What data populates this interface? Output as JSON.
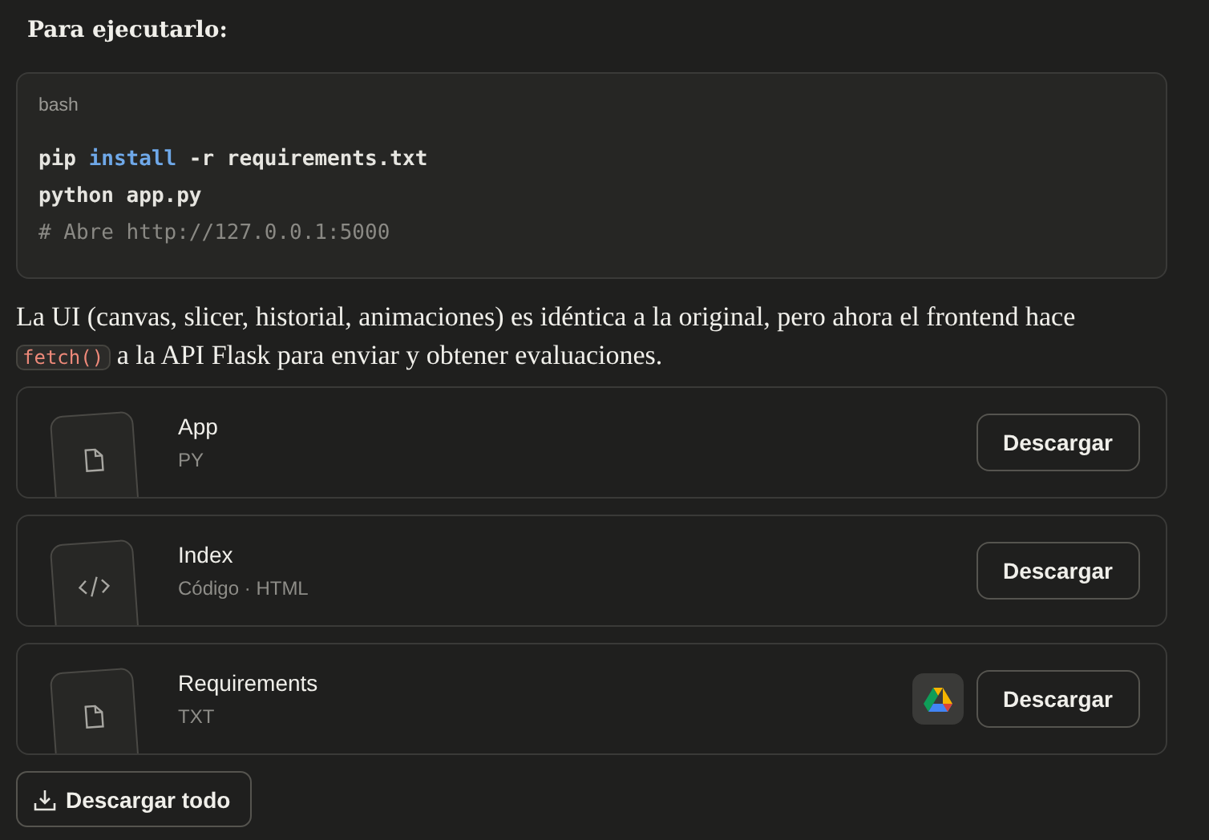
{
  "heading": "Para ejecutarlo:",
  "code_block": {
    "language": "bash",
    "lines": [
      [
        {
          "kind": "plain",
          "text": "pip "
        },
        {
          "kind": "keyword",
          "text": "install"
        },
        {
          "kind": "plain",
          "text": " -r requirements.txt"
        }
      ],
      [
        {
          "kind": "plain",
          "text": "python app.py"
        }
      ],
      [
        {
          "kind": "comment",
          "text": "# Abre http://127.0.0.1:5000"
        }
      ]
    ]
  },
  "paragraph": [
    {
      "kind": "text",
      "text": "La UI (canvas, slicer, historial, animaciones) es idéntica a la original, pero ahora el frontend hace "
    },
    {
      "kind": "code",
      "text": "fetch()"
    },
    {
      "kind": "text",
      "text": " a la API Flask para enviar y obtener evaluaciones."
    }
  ],
  "files": [
    {
      "name": "App",
      "type": "PY",
      "kind": "file",
      "drive": false,
      "button": "Descargar"
    },
    {
      "name": "Index",
      "type": "Código · HTML",
      "kind": "code",
      "drive": false,
      "button": "Descargar"
    },
    {
      "name": "Requirements",
      "type": "TXT",
      "kind": "file",
      "drive": true,
      "button": "Descargar"
    }
  ],
  "download_all": "Descargar todo"
}
